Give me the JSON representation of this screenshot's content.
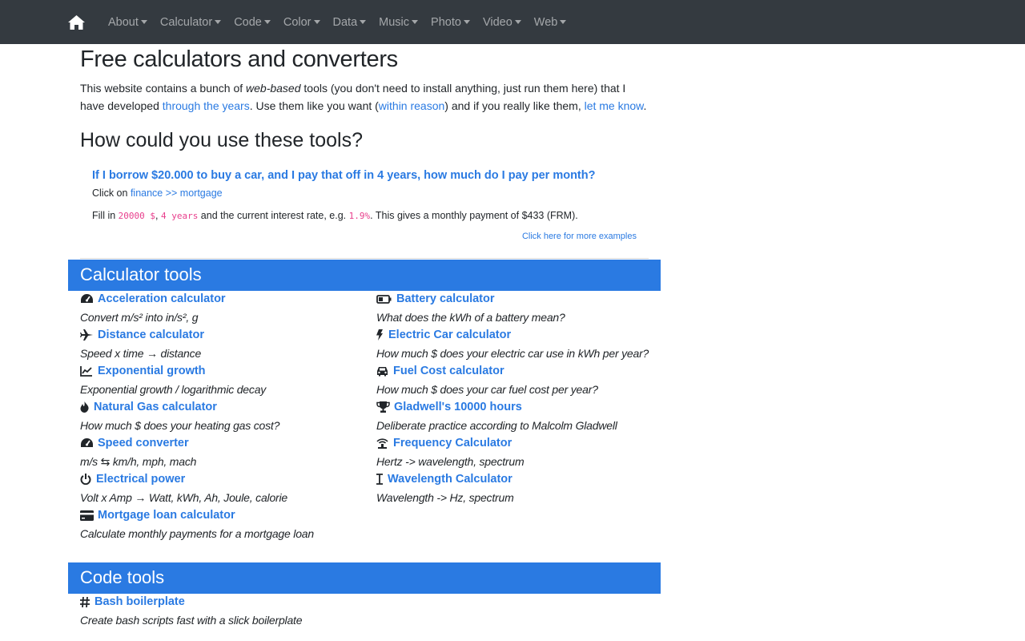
{
  "nav": {
    "items": [
      {
        "label": "About"
      },
      {
        "label": "Calculator"
      },
      {
        "label": "Code"
      },
      {
        "label": "Color"
      },
      {
        "label": "Data"
      },
      {
        "label": "Music"
      },
      {
        "label": "Photo"
      },
      {
        "label": "Video"
      },
      {
        "label": "Web"
      }
    ]
  },
  "page": {
    "title": "Free calculators and converters",
    "intro": {
      "p1": "This website contains a bunch of ",
      "em": "web-based",
      "p2": " tools (you don't need to install anything, just run them here) that I have developed ",
      "link1": "through the years",
      "p3": ". Use them like you want (",
      "link2": "within reason",
      "p4": ") and if you really like them, ",
      "link3": "let me know",
      "p5": "."
    },
    "how_title": "How could you use these tools?",
    "example": {
      "question": "If I borrow $20.000 to buy a car, and I pay that off in 4 years, how much do I pay per month?",
      "click_prefix": "Click on ",
      "click_link": "finance >> mortgage",
      "fill_prefix": "Fill in ",
      "code1": "20000 $",
      "sep": ", ",
      "code2": "4 years",
      "fill_mid": " and the current interest rate, e.g. ",
      "code3": "1.9%",
      "fill_end": ". This gives a monthly payment of $433 (FRM).",
      "more": "Click here for more examples"
    }
  },
  "calculator_section": {
    "title": "Calculator tools",
    "left": [
      {
        "icon": "tachometer-icon",
        "title": "Acceleration calculator",
        "desc": "Convert m/s² into in/s², g"
      },
      {
        "icon": "plane-icon",
        "title": "Distance calculator",
        "desc": "Speed x time → distance"
      },
      {
        "icon": "line-chart-icon",
        "title": "Exponential growth",
        "desc": "Exponential growth / logarithmic decay"
      },
      {
        "icon": "fire-icon",
        "title": "Natural Gas calculator",
        "desc": "How much $ does your heating gas cost?"
      },
      {
        "icon": "tachometer-icon",
        "title": "Speed converter",
        "desc": "m/s ⇆ km/h, mph, mach"
      },
      {
        "icon": "power-icon",
        "title": "Electrical power",
        "desc": "Volt x Amp → Watt, kWh, Ah, Joule, calorie"
      },
      {
        "icon": "credit-card-icon",
        "title": "Mortgage loan calculator",
        "desc": "Calculate monthly payments for a mortgage loan"
      }
    ],
    "right": [
      {
        "icon": "battery-icon",
        "title": "Battery calculator",
        "desc": "What does the kWh of a battery mean?"
      },
      {
        "icon": "bolt-icon",
        "title": "Electric Car calculator",
        "desc": "How much $ does your electric car use in kWh per year?"
      },
      {
        "icon": "car-icon",
        "title": "Fuel Cost calculator",
        "desc": "How much $ does your car fuel cost per year?"
      },
      {
        "icon": "trophy-icon",
        "title": "Gladwell's 10000 hours",
        "desc": "Deliberate practice according to Malcolm Gladwell"
      },
      {
        "icon": "wifi-tower-icon",
        "title": "Frequency Calculator",
        "desc": "Hertz -> wavelength, spectrum"
      },
      {
        "icon": "text-cursor-icon",
        "title": "Wavelength Calculator",
        "desc": "Wavelength -> Hz, spectrum"
      }
    ]
  },
  "code_section": {
    "title": "Code tools",
    "items": [
      {
        "icon": "hashtag-icon",
        "title": "Bash boilerplate",
        "desc": "Create bash scripts fast with a slick boilerplate"
      }
    ]
  }
}
